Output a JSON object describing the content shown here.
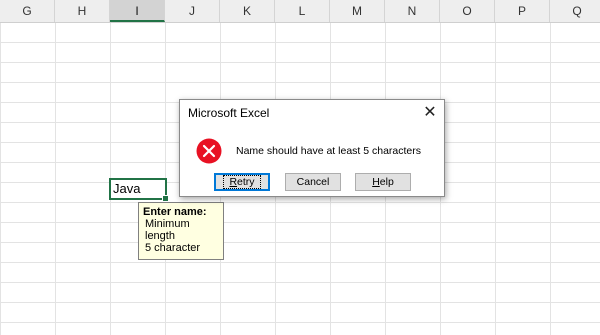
{
  "columns": [
    {
      "label": "G",
      "active": false
    },
    {
      "label": "H",
      "active": false
    },
    {
      "label": "I",
      "active": true
    },
    {
      "label": "J",
      "active": false
    },
    {
      "label": "K",
      "active": false
    },
    {
      "label": "L",
      "active": false
    },
    {
      "label": "M",
      "active": false
    },
    {
      "label": "N",
      "active": false
    },
    {
      "label": "O",
      "active": false
    },
    {
      "label": "P",
      "active": false
    },
    {
      "label": "Q",
      "active": false
    }
  ],
  "cell": {
    "value": "Java"
  },
  "tooltip": {
    "title": "Enter name:",
    "line1": "Minimum length",
    "line2": "5 character"
  },
  "dialog": {
    "title": "Microsoft Excel",
    "close_glyph": "✕",
    "message": "Name should have at least 5 characters",
    "icon": "error-icon",
    "buttons": {
      "retry": {
        "mnemonic": "R",
        "rest": "etry"
      },
      "cancel": {
        "label": "Cancel"
      },
      "help": {
        "mnemonic": "H",
        "rest": "elp"
      }
    }
  },
  "colors": {
    "accent": "#217346",
    "error": "#e81123",
    "tooltip_bg": "#ffffe1"
  }
}
